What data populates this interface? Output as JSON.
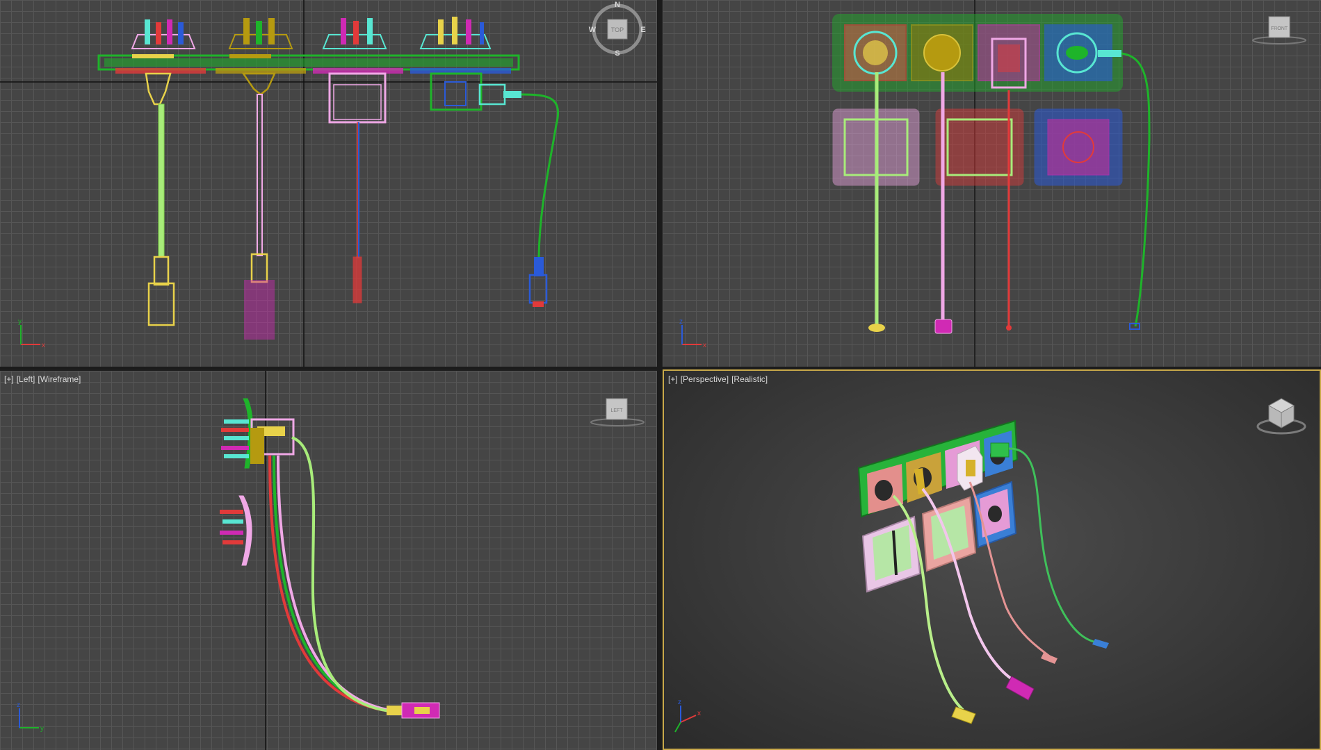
{
  "viewports": {
    "left": {
      "menu_plus": "[+]",
      "view_name": "[Left]",
      "shading": "[Wireframe]",
      "cube_label": "LEFT"
    },
    "perspective": {
      "menu_plus": "[+]",
      "view_name": "[Perspective]",
      "shading": "[Realistic]"
    },
    "top": {
      "compass": {
        "n": "N",
        "s": "S",
        "e": "E",
        "w": "W",
        "cube_label": "TOP"
      }
    },
    "front": {
      "cube_label": "FRONT"
    }
  },
  "axis": {
    "x": "x",
    "y": "y",
    "z": "z"
  },
  "colors": {
    "active_border": "#c9a94a",
    "grid_bg": "#454545",
    "grid_line": "#565656",
    "green": "#1eb42a",
    "yellow": "#e8d24a",
    "olive": "#b59a10",
    "pink": "#f0a8e6",
    "magenta": "#d02ab4",
    "red": "#e23a3a",
    "blue": "#2a5ad8",
    "cyan": "#58e6d2",
    "light_green": "#a8ec7a"
  }
}
